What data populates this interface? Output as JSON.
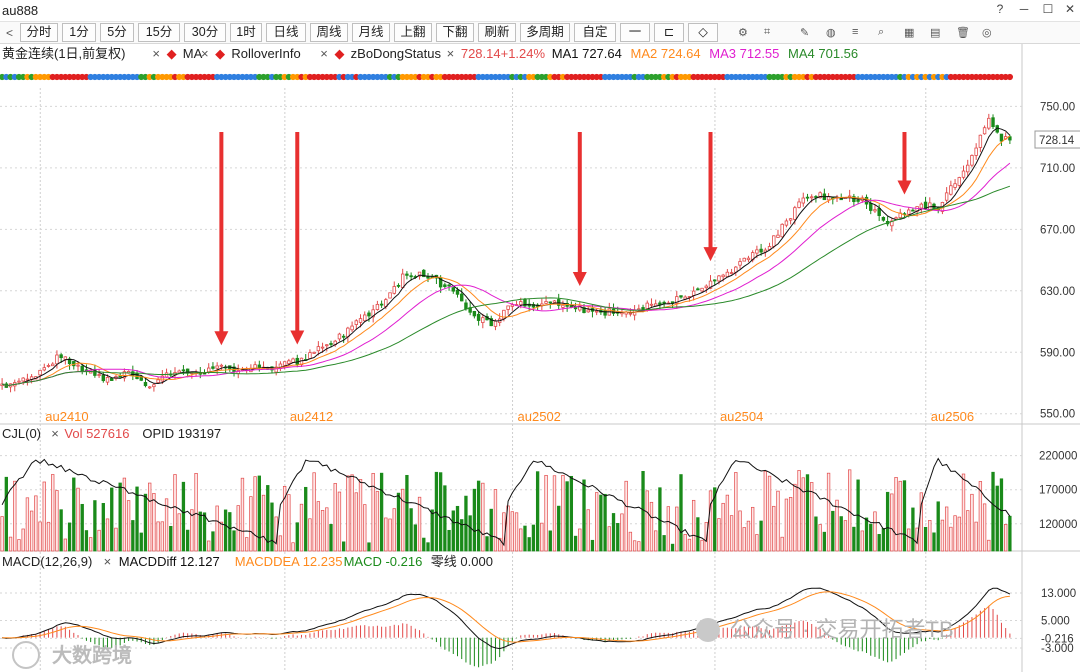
{
  "window": {
    "title": "au888"
  },
  "toolbar": {
    "buttons": [
      "分时",
      "1分",
      "5分",
      "15分",
      "30分",
      "1时",
      "日线",
      "周线",
      "月线",
      "上翻",
      "下翻",
      "刷新",
      "多周期",
      "自定",
      "一",
      "⊏",
      "◇"
    ],
    "left_arrow": "<"
  },
  "main_panel": {
    "name": "黄金连续(1日,前复权)",
    "indicators": [
      "MA",
      "RolloverInfo",
      "zBoDongStatus"
    ],
    "price_info": "728.14+1.24%",
    "ma_values": [
      {
        "label": "MA1",
        "value": "727.64",
        "color": "#111111"
      },
      {
        "label": "MA2",
        "value": "724.64",
        "color": "#ff8a1d"
      },
      {
        "label": "MA3",
        "value": "712.55",
        "color": "#e01fd0"
      },
      {
        "label": "MA4",
        "value": "701.56",
        "color": "#2a8a2a"
      }
    ],
    "y_ticks": [
      "750.00",
      "710.00",
      "670.00",
      "630.00",
      "590.00",
      "550.00"
    ],
    "last_price_tag": "728.14",
    "contracts": [
      "au2410",
      "au2412",
      "au2502",
      "au2504",
      "au2506"
    ]
  },
  "vol_panel": {
    "label": "CJL(0)",
    "vol": "Vol 527616",
    "opid": "OPID 193197",
    "y_ticks": [
      "220000",
      "170000",
      "120000"
    ]
  },
  "macd_panel": {
    "label": "MACD(12,26,9)",
    "diff": "MACDDiff 12.127",
    "dea": "MACDDEA 12.235",
    "macd": "MACD -0.216",
    "zero": "零线 0.000",
    "y_ticks": [
      "13.000",
      "5.000",
      "-0.216",
      "-3.000"
    ]
  },
  "watermarks": {
    "left": "大数跨境",
    "right": "公众号 · 交易开拓者TB"
  },
  "colors": {
    "up": "#e24a4a",
    "down": "#1a8a1a",
    "arrow": "#e83030",
    "contract": "#ff8a1d",
    "upVolFill": "#ffe6e6"
  },
  "chart_data": {
    "type": "candlestick",
    "title": "黄金连续(1日,前复权)",
    "n_bars": 240,
    "price_range": [
      542,
      762
    ],
    "keyframes": [
      [
        0,
        568
      ],
      [
        8,
        576
      ],
      [
        14,
        588
      ],
      [
        18,
        580
      ],
      [
        26,
        572
      ],
      [
        30,
        578
      ],
      [
        34,
        568
      ],
      [
        38,
        574
      ],
      [
        46,
        578
      ],
      [
        56,
        580
      ],
      [
        64,
        580
      ],
      [
        72,
        586
      ],
      [
        82,
        604
      ],
      [
        90,
        622
      ],
      [
        96,
        642
      ],
      [
        100,
        640
      ],
      [
        106,
        632
      ],
      [
        112,
        614
      ],
      [
        116,
        608
      ],
      [
        120,
        620
      ],
      [
        130,
        622
      ],
      [
        140,
        616
      ],
      [
        150,
        618
      ],
      [
        158,
        622
      ],
      [
        166,
        630
      ],
      [
        176,
        650
      ],
      [
        182,
        660
      ],
      [
        190,
        690
      ],
      [
        196,
        692
      ],
      [
        204,
        688
      ],
      [
        210,
        676
      ],
      [
        218,
        686
      ],
      [
        222,
        684
      ],
      [
        230,
        716
      ],
      [
        234,
        742
      ],
      [
        237,
        728
      ],
      [
        239,
        728
      ]
    ],
    "arrow_indices": [
      52,
      70,
      137,
      168,
      214
    ],
    "contract_indices": [
      10,
      68,
      122,
      170,
      220
    ],
    "last_price": 728.14,
    "ma_last": {
      "MA1": 727.64,
      "MA2": 724.64,
      "MA3": 712.55,
      "MA4": 701.56
    },
    "volume_range": [
      80000,
      240000
    ],
    "volume_last": 220000,
    "macd_range": [
      -10,
      20
    ],
    "macd_last": {
      "diff": 12.127,
      "dea": 12.235,
      "macd": -0.216
    }
  }
}
